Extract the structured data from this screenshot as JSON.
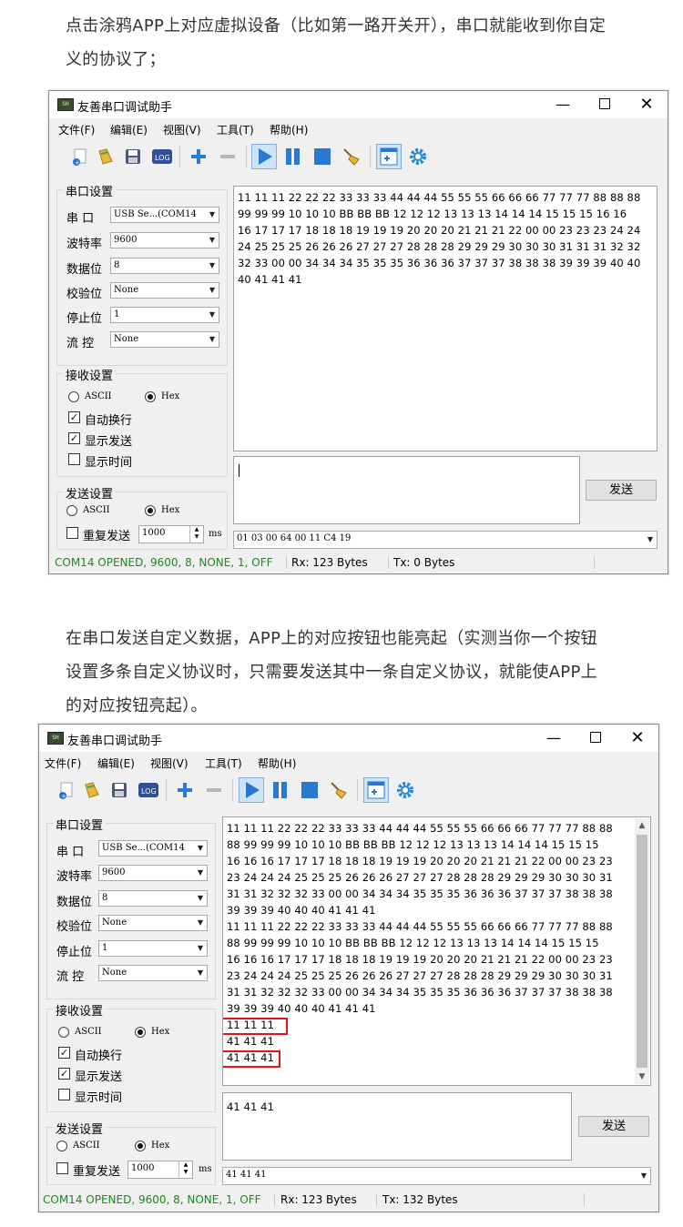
{
  "para1": [
    "点击涂鸦APP上对应虚拟设备（比如第一路开关开），串口就能收到你自定",
    "义的协议了；"
  ],
  "para2": [
    "在串口发送自定义数据，APP上的对应按钮也能亮起（实测当你一个按钮",
    "设置多条自定义协议时，只需要发送其中一条自定义协议，就能使APP上",
    "的对应按钮亮起）。"
  ],
  "win1": {
    "title": "友善串口调试助手",
    "menu": [
      "文件(F)",
      "编辑(E)",
      "视图(V)",
      "工具(T)",
      "帮助(H)"
    ],
    "serial": {
      "group": "串口设置",
      "port_label": "串  口",
      "port": "USB Se...(COM14",
      "baud_label": "波特率",
      "baud": "9600",
      "data_label": "数据位",
      "data": "8",
      "parity_label": "校验位",
      "parity": "None",
      "stop_label": "停止位",
      "stop": "1",
      "flow_label": "流  控",
      "flow": "None"
    },
    "recv": {
      "group": "接收设置",
      "ascii": "ASCII",
      "hex": "Hex",
      "auto_wrap": "自动换行",
      "show_send": "显示发送",
      "show_time": "显示时间"
    },
    "send": {
      "group": "发送设置",
      "ascii": "ASCII",
      "hex": "Hex",
      "repeat": "重复发送",
      "interval": "1000",
      "unit": "ms",
      "button": "发送"
    },
    "receive_lines": [
      "11 11 11 22 22 22 33 33 33 44 44 44 55 55 55 66 66 66 77 77 77 88 88 88",
      "99 99 99 10 10 10 BB BB BB 12 12 12 13 13 13 14 14 14 15 15 15 16 16",
      "16 17 17 17 18 18 18 19 19 19 20 20 20 21 21 21 22 00 00 23 23 23 24 24",
      "24 25 25 25 26 26 26 27 27 27 28 28 28 29 29 29 30 30 30 31 31 31 32 32",
      "32 33 00 00 34 34 34 35 35 35 36 36 36 37 37 37 38 38 38 39 39 39 40 40",
      "40 41 41 41"
    ],
    "send_text": "",
    "history": "01 03 00 64 00 11 C4 19",
    "status": {
      "port": "COM14 OPENED, 9600, 8, NONE, 1, OFF",
      "rx": "Rx: 123 Bytes",
      "tx": "Tx: 0 Bytes"
    },
    "colors": {
      "status_port": "#1a8a1a"
    }
  },
  "win2": {
    "title": "友善串口调试助手",
    "menu": [
      "文件(F)",
      "编辑(E)",
      "视图(V)",
      "工具(T)",
      "帮助(H)"
    ],
    "serial": {
      "group": "串口设置",
      "port_label": "串  口",
      "port": "USB Se...(COM14",
      "baud_label": "波特率",
      "baud": "9600",
      "data_label": "数据位",
      "data": "8",
      "parity_label": "校验位",
      "parity": "None",
      "stop_label": "停止位",
      "stop": "1",
      "flow_label": "流  控",
      "flow": "None"
    },
    "recv": {
      "group": "接收设置",
      "ascii": "ASCII",
      "hex": "Hex",
      "auto_wrap": "自动换行",
      "show_send": "显示发送",
      "show_time": "显示时间"
    },
    "send": {
      "group": "发送设置",
      "ascii": "ASCII",
      "hex": "Hex",
      "repeat": "重复发送",
      "interval": "1000",
      "unit": "ms",
      "button": "发送"
    },
    "receive_lines": [
      "11 11 11 22 22 22 33 33 33 44 44 44 55 55 55 66 66 66 77 77 77 88 88",
      "88 99 99 99 10 10 10 BB BB BB 12 12 12 13 13 13 14 14 14 15 15 15",
      "16 16 16 17 17 17 18 18 18 19 19 19 20 20 20 21 21 21 22 00 00 23 23",
      "23 24 24 24 25 25 25 26 26 26 27 27 27 28 28 28 29 29 29 30 30 30 31",
      "31 31 32 32 32 33 00 00 34 34 34 35 35 35 36 36 36 37 37 37 38 38 38",
      "39 39 39 40 40 40 41 41 41",
      "11 11 11 22 22 22 33 33 33 44 44 44 55 55 55 66 66 66 77 77 77 88 88",
      "88 99 99 99 10 10 10 BB BB BB 12 12 12 13 13 13 14 14 14 15 15 15",
      "16 16 16 17 17 17 18 18 18 19 19 19 20 20 20 21 21 21 22 00 00 23 23",
      "23 24 24 24 25 25 25 26 26 26 27 27 27 28 28 28 29 29 29 30 30 30 31",
      "31 31 32 32 32 33 00 00 34 34 34 35 35 35 36 36 36 37 37 37 38 38 38",
      "39 39 39 40 40 40 41 41 41",
      "11 11 11",
      "41 41 41",
      "41 41 41"
    ],
    "send_text": "41 41 41",
    "history": "41 41 41",
    "status": {
      "port": "COM14 OPENED, 9600, 8, NONE, 1, OFF",
      "rx": "Rx: 123 Bytes",
      "tx": "Tx: 132 Bytes"
    }
  }
}
